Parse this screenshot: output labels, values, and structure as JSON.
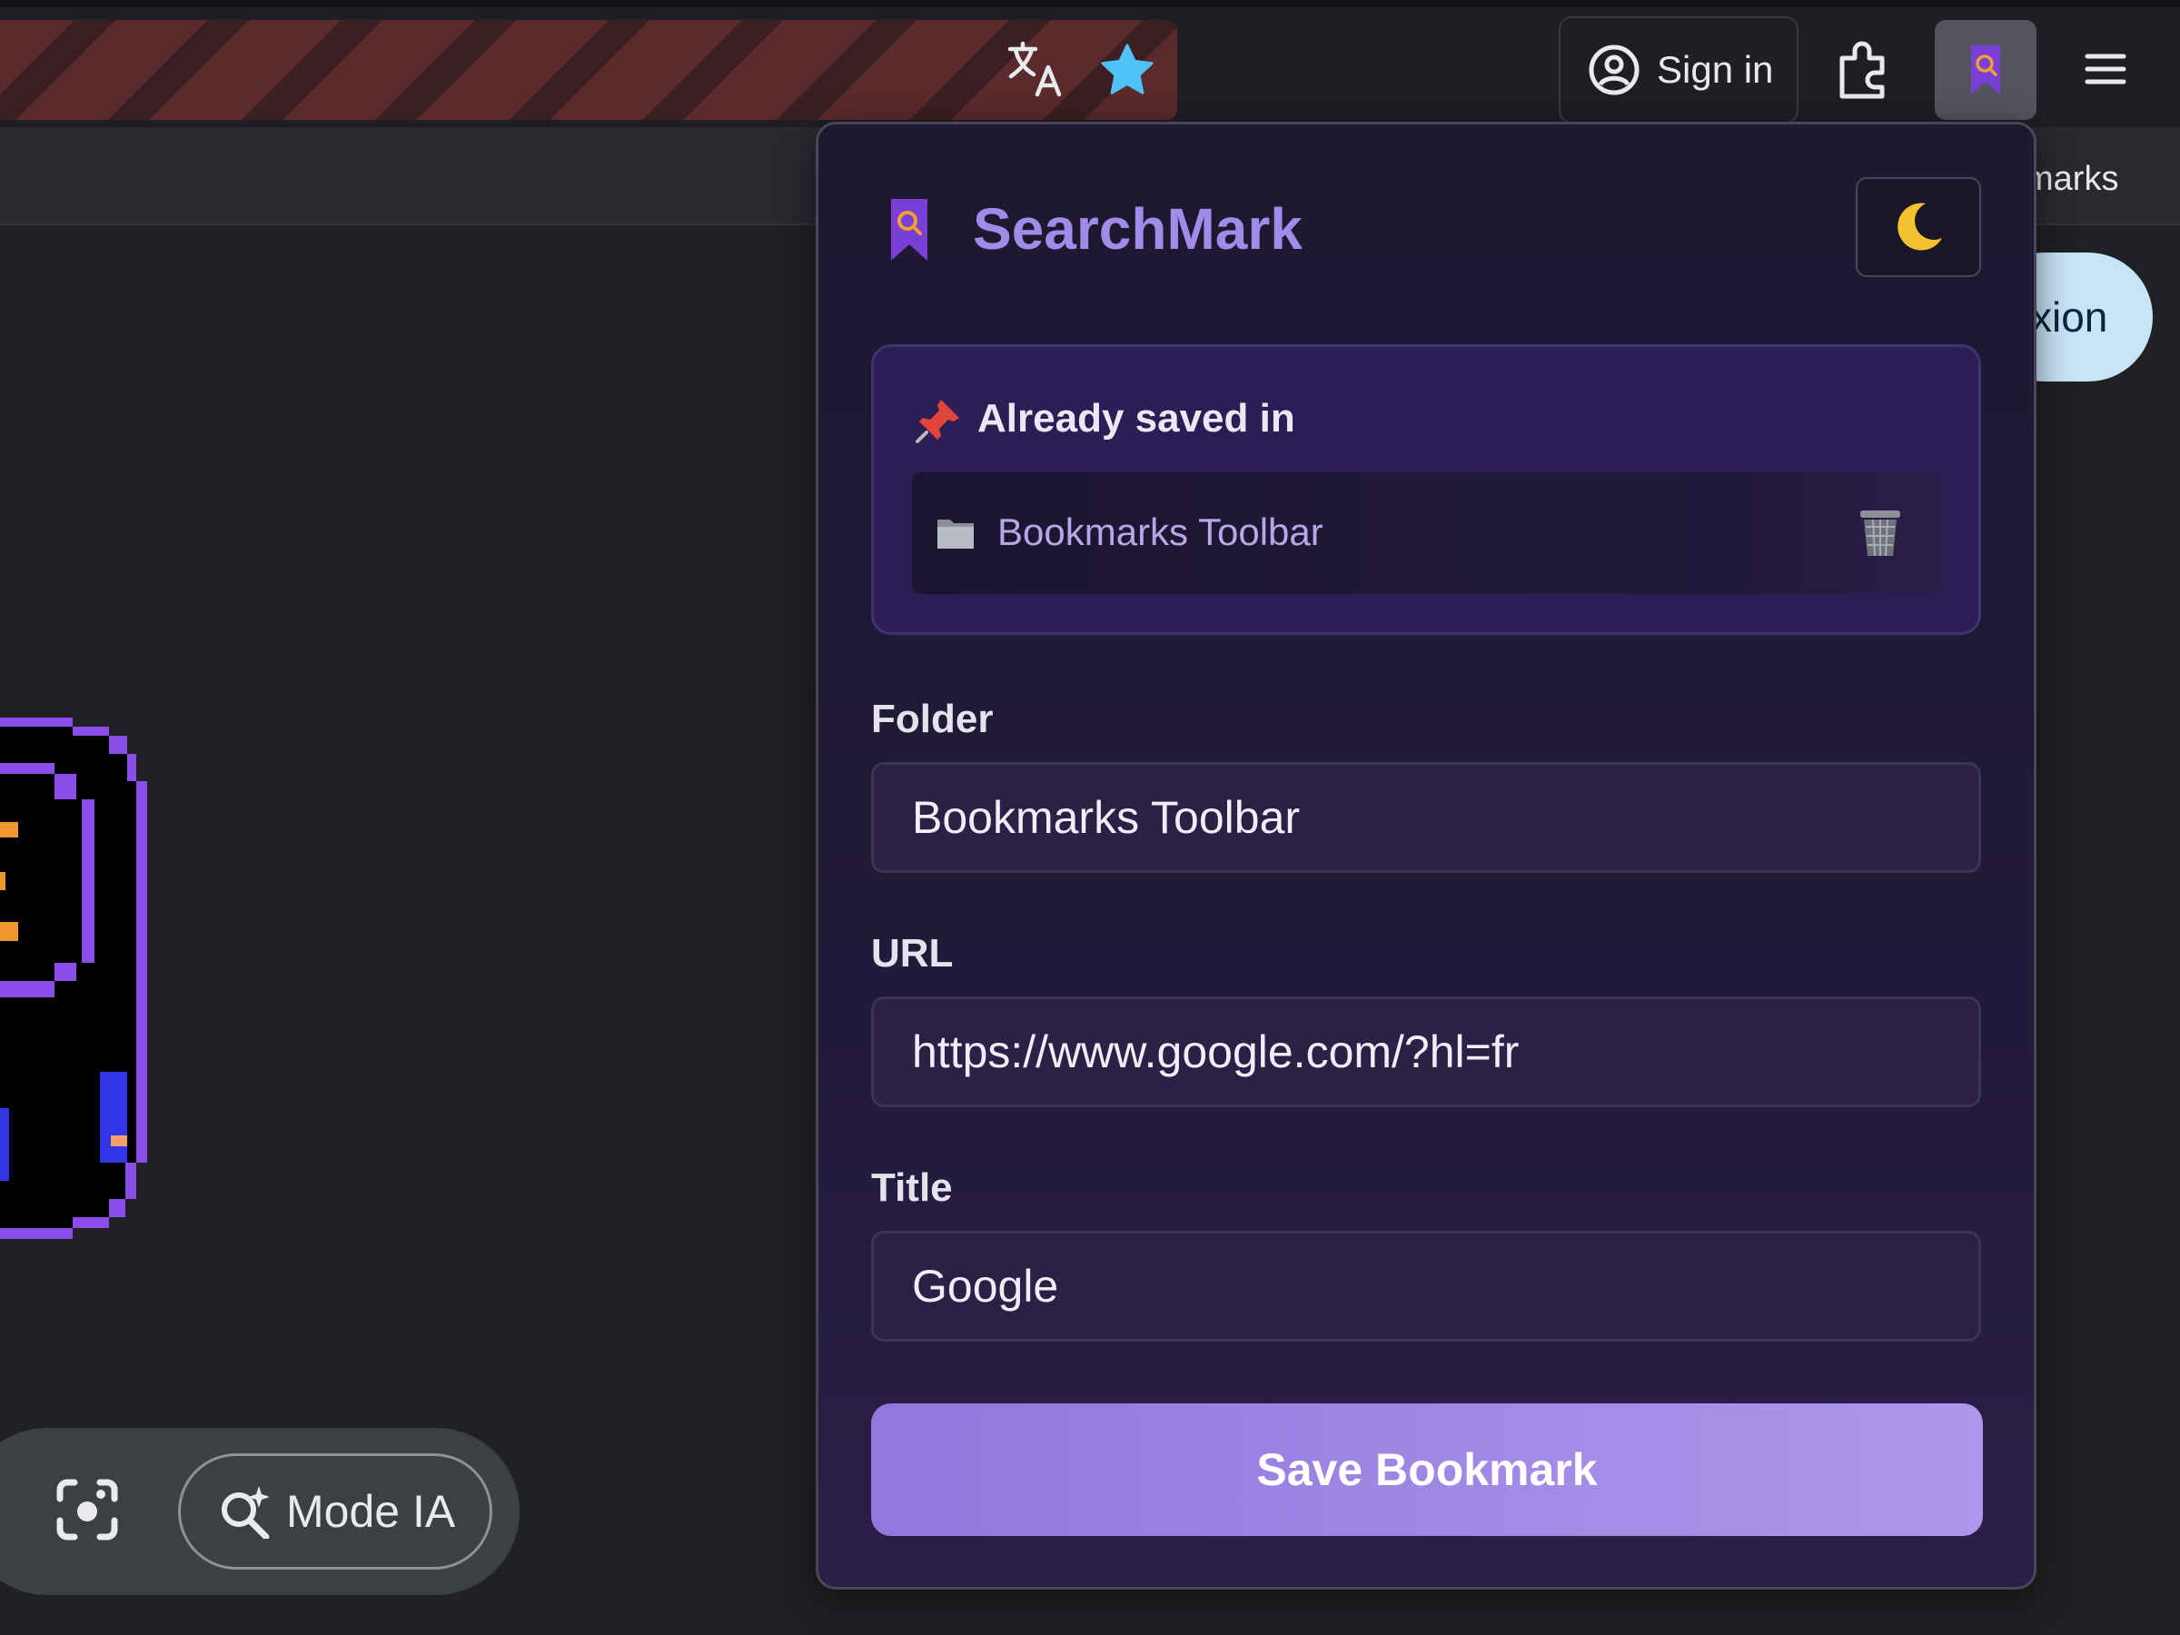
{
  "browser": {
    "signin_label": "Sign in",
    "bookmarks_bar_fragment": "kmarks",
    "connexion_fragment": "xion",
    "icons": [
      "translate-icon",
      "star-icon",
      "avatar-icon",
      "extensions-icon",
      "searchmark-extension-icon",
      "menu-icon"
    ],
    "accent_star_color": "#4fc3f7"
  },
  "page": {
    "mode_ia_label": "Mode IA",
    "icons": [
      "lens-icon",
      "ai-search-icon"
    ]
  },
  "popup": {
    "title": "SearchMark",
    "theme_toggle_icon": "moon-icon",
    "already_saved": {
      "heading": "Already saved in",
      "items": [
        {
          "label": "Bookmarks Toolbar"
        }
      ]
    },
    "fields": {
      "folder": {
        "label": "Folder",
        "value": "Bookmarks Toolbar"
      },
      "url": {
        "label": "URL",
        "value": "https://www.google.com/?hl=fr"
      },
      "title": {
        "label": "Title",
        "value": "Google"
      }
    },
    "save_label": "Save Bookmark",
    "colors": {
      "brand": "#a08be8",
      "button_start": "#9277dd",
      "button_end": "#ae97ec"
    }
  }
}
